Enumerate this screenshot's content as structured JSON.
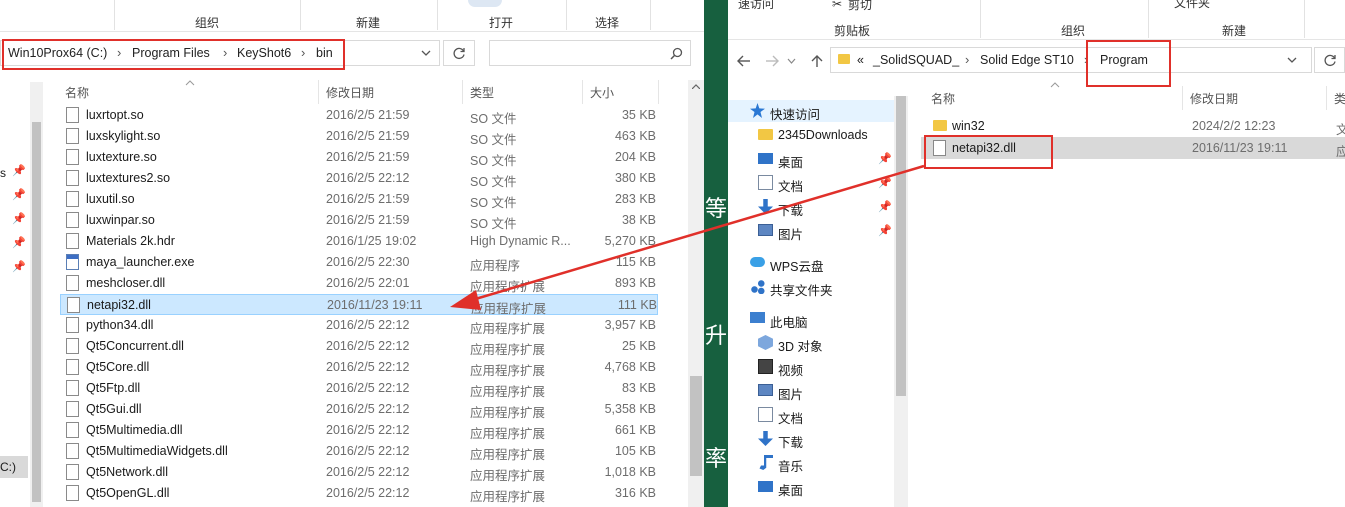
{
  "left": {
    "ribbon": {
      "group1": "组织",
      "group2": "新建",
      "group3": "打开",
      "group4": "选择"
    },
    "address": {
      "crumbs": [
        "Win10Prox64 (C:)",
        "Program Files",
        "KeyShot6",
        "bin"
      ],
      "separator": "›"
    },
    "columns": {
      "name": "名称",
      "date": "修改日期",
      "type": "类型",
      "size": "大小"
    },
    "nav": {
      "drive_fragment": "C:)",
      "fragment_s": "s"
    },
    "files": [
      {
        "name": "luxrtopt.so",
        "date": "2016/2/5 21:59",
        "type": "SO 文件",
        "size": "35 KB"
      },
      {
        "name": "luxskylight.so",
        "date": "2016/2/5 21:59",
        "type": "SO 文件",
        "size": "463 KB"
      },
      {
        "name": "luxtexture.so",
        "date": "2016/2/5 21:59",
        "type": "SO 文件",
        "size": "204 KB"
      },
      {
        "name": "luxtextures2.so",
        "date": "2016/2/5 22:12",
        "type": "SO 文件",
        "size": "380 KB"
      },
      {
        "name": "luxutil.so",
        "date": "2016/2/5 21:59",
        "type": "SO 文件",
        "size": "283 KB"
      },
      {
        "name": "luxwinpar.so",
        "date": "2016/2/5 21:59",
        "type": "SO 文件",
        "size": "38 KB"
      },
      {
        "name": "Materials 2k.hdr",
        "date": "2016/1/25 19:02",
        "type": "High Dynamic R...",
        "size": "5,270 KB"
      },
      {
        "name": "maya_launcher.exe",
        "date": "2016/2/5 22:30",
        "type": "应用程序",
        "size": "115 KB"
      },
      {
        "name": "meshcloser.dll",
        "date": "2016/2/5 22:01",
        "type": "应用程序扩展",
        "size": "893 KB"
      },
      {
        "name": "netapi32.dll",
        "date": "2016/11/23 19:11",
        "type": "应用程序扩展",
        "size": "111 KB"
      },
      {
        "name": "python34.dll",
        "date": "2016/2/5 22:12",
        "type": "应用程序扩展",
        "size": "3,957 KB"
      },
      {
        "name": "Qt5Concurrent.dll",
        "date": "2016/2/5 22:12",
        "type": "应用程序扩展",
        "size": "25 KB"
      },
      {
        "name": "Qt5Core.dll",
        "date": "2016/2/5 22:12",
        "type": "应用程序扩展",
        "size": "4,768 KB"
      },
      {
        "name": "Qt5Ftp.dll",
        "date": "2016/2/5 22:12",
        "type": "应用程序扩展",
        "size": "83 KB"
      },
      {
        "name": "Qt5Gui.dll",
        "date": "2016/2/5 22:12",
        "type": "应用程序扩展",
        "size": "5,358 KB"
      },
      {
        "name": "Qt5Multimedia.dll",
        "date": "2016/2/5 22:12",
        "type": "应用程序扩展",
        "size": "661 KB"
      },
      {
        "name": "Qt5MultimediaWidgets.dll",
        "date": "2016/2/5 22:12",
        "type": "应用程序扩展",
        "size": "105 KB"
      },
      {
        "name": "Qt5Network.dll",
        "date": "2016/2/5 22:12",
        "type": "应用程序扩展",
        "size": "1,018 KB"
      },
      {
        "name": "Qt5OpenGL.dll",
        "date": "2016/2/5 22:12",
        "type": "应用程序扩展",
        "size": "316 KB"
      }
    ]
  },
  "strip": {
    "chars": [
      "等",
      "升",
      "率"
    ]
  },
  "right": {
    "ribbon": {
      "top_left": "速访问",
      "cut": "剪切",
      "clipboard": "剪贴板",
      "organize": "组织",
      "new": "新建",
      "top_right": "文件夹"
    },
    "address": {
      "prefix": "«",
      "crumbs": [
        "_SolidSQUAD_",
        "Solid Edge ST10",
        "Program"
      ],
      "separator": "›"
    },
    "columns": {
      "name": "名称",
      "date": "修改日期",
      "type_fragment": "类"
    },
    "nav": [
      {
        "label": "快速访问",
        "icon": "star-icon"
      },
      {
        "label": "2345Downloads",
        "icon": "folder-icon"
      },
      {
        "label": "桌面",
        "icon": "desktop-icon"
      },
      {
        "label": "文档",
        "icon": "document-icon"
      },
      {
        "label": "下载",
        "icon": "download-icon"
      },
      {
        "label": "图片",
        "icon": "picture-icon"
      },
      {
        "label": "WPS云盘",
        "icon": "cloud-icon"
      },
      {
        "label": "共享文件夹",
        "icon": "share-icon"
      },
      {
        "label": "此电脑",
        "icon": "computer-icon"
      },
      {
        "label": "3D 对象",
        "icon": "cube-icon"
      },
      {
        "label": "视频",
        "icon": "video-icon"
      },
      {
        "label": "图片",
        "icon": "picture-icon"
      },
      {
        "label": "文档",
        "icon": "document-icon"
      },
      {
        "label": "下载",
        "icon": "download-icon"
      },
      {
        "label": "音乐",
        "icon": "music-icon"
      },
      {
        "label": "桌面",
        "icon": "desktop-icon"
      }
    ],
    "files": [
      {
        "name": "win32",
        "date": "2024/2/2 12:23",
        "type": "文"
      },
      {
        "name": "netapi32.dll",
        "date": "2016/11/23 19:11",
        "type": "应"
      }
    ]
  },
  "colors": {
    "highlight_red": "#e0302a",
    "selection": "#cce8ff",
    "strip_green": "#17603f"
  }
}
